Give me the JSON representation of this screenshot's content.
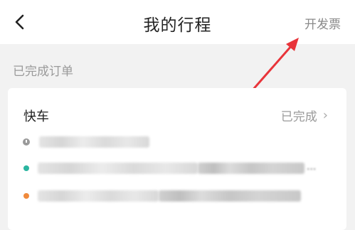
{
  "header": {
    "back_icon": "chevron-left-icon",
    "title": "我的行程",
    "invoice_label": "开发票",
    "annotation_color": "#e8343a"
  },
  "section": {
    "label": "已完成订单"
  },
  "trip": {
    "type": "快车",
    "status": "已完成",
    "status_chevron": "›",
    "time_icon": "clock-icon",
    "start_dot_color": "#2bb5a0",
    "end_dot_color": "#f08a3c",
    "start_tail": "...",
    "end_tail": "..."
  }
}
